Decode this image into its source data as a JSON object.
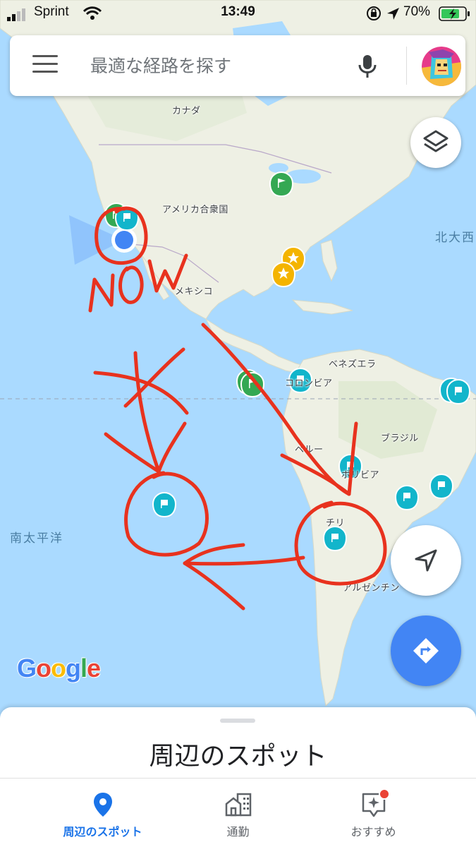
{
  "status_bar": {
    "carrier": "Sprint",
    "time": "13:49",
    "battery": "70%"
  },
  "search": {
    "placeholder": "最適な経路を探す"
  },
  "map": {
    "labels": {
      "canada": "カナダ",
      "usa": "アメリカ合衆国",
      "mexico": "メキシコ",
      "north_atlantic": "北大西",
      "venezuela": "ベネズエラ",
      "colombia": "コロンビア",
      "brazil": "ブラジル",
      "peru": "ペルー",
      "bolivia": "ボリビア",
      "chile": "チリ",
      "argentina": "アルゼンチン",
      "south_pacific": "南太平洋"
    },
    "annotation_text": "NOW",
    "colors": {
      "water": "#aadaff",
      "land": "#eef0e4",
      "annotation": "#e8321e",
      "pin_teal": "#12b5cb",
      "pin_green": "#34a853",
      "pin_gold": "#f4b400",
      "location_dot": "#4285f4"
    }
  },
  "google_logo": {
    "letters": [
      "G",
      "o",
      "o",
      "g",
      "l",
      "e"
    ]
  },
  "bottom_sheet": {
    "title": "周辺のスポット"
  },
  "bottom_nav": {
    "items": [
      {
        "label": "周辺のスポット",
        "icon": "location-pin-icon",
        "active": true
      },
      {
        "label": "通勤",
        "icon": "commute-building-icon",
        "active": false
      },
      {
        "label": "おすすめ",
        "icon": "sparkle-badge-icon",
        "active": false
      }
    ]
  }
}
